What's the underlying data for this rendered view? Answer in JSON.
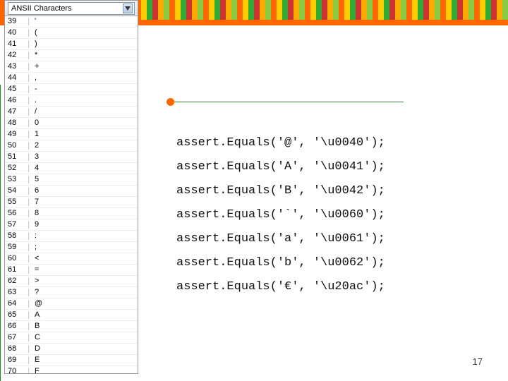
{
  "panel": {
    "dropdown_label": "ANSII Characters",
    "rows": [
      {
        "code": "39",
        "char": "'"
      },
      {
        "code": "40",
        "char": "("
      },
      {
        "code": "41",
        "char": ")"
      },
      {
        "code": "42",
        "char": "*"
      },
      {
        "code": "43",
        "char": "+"
      },
      {
        "code": "44",
        "char": ","
      },
      {
        "code": "45",
        "char": "-"
      },
      {
        "code": "46",
        "char": "."
      },
      {
        "code": "47",
        "char": "/"
      },
      {
        "code": "48",
        "char": "0"
      },
      {
        "code": "49",
        "char": "1"
      },
      {
        "code": "50",
        "char": "2"
      },
      {
        "code": "51",
        "char": "3"
      },
      {
        "code": "52",
        "char": "4"
      },
      {
        "code": "53",
        "char": "5"
      },
      {
        "code": "54",
        "char": "6"
      },
      {
        "code": "55",
        "char": "7"
      },
      {
        "code": "56",
        "char": "8"
      },
      {
        "code": "57",
        "char": "9"
      },
      {
        "code": "58",
        "char": ":"
      },
      {
        "code": "59",
        "char": ";"
      },
      {
        "code": "60",
        "char": "<"
      },
      {
        "code": "61",
        "char": "="
      },
      {
        "code": "62",
        "char": ">"
      },
      {
        "code": "63",
        "char": "?"
      },
      {
        "code": "64",
        "char": "@"
      },
      {
        "code": "65",
        "char": "A"
      },
      {
        "code": "66",
        "char": "B"
      },
      {
        "code": "67",
        "char": "C"
      },
      {
        "code": "68",
        "char": "D"
      },
      {
        "code": "69",
        "char": "E"
      },
      {
        "code": "70",
        "char": "F"
      }
    ]
  },
  "code": {
    "lines": [
      "assert.Equals('@', '\\u0040');",
      "assert.Equals('A', '\\u0041');",
      "assert.Equals('B', '\\u0042');",
      "assert.Equals('`', '\\u0060');",
      "assert.Equals('a', '\\u0061');",
      "assert.Equals('b', '\\u0062');",
      "assert.Equals('€', '\\u20ac');"
    ]
  },
  "page_number": "17"
}
